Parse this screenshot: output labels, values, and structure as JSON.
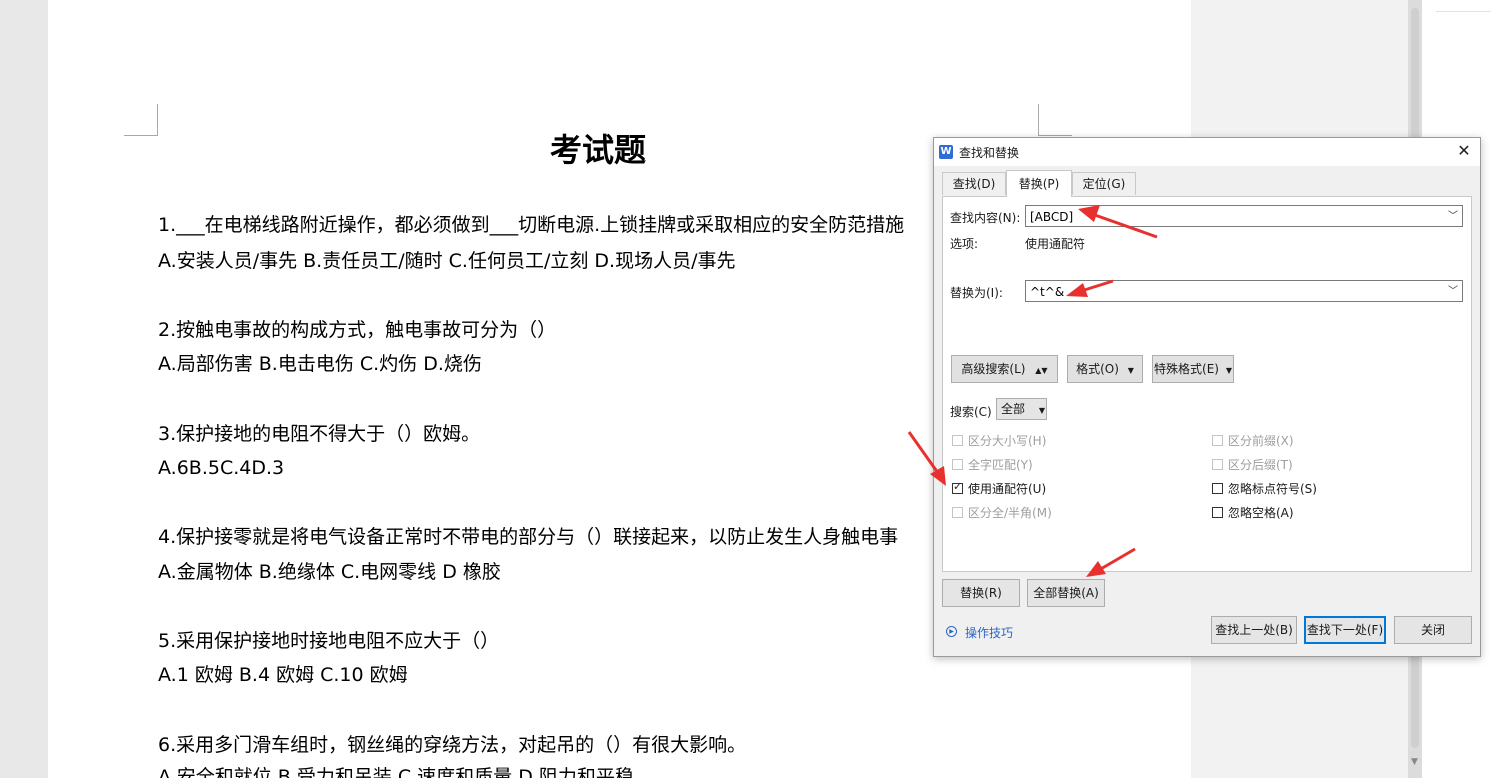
{
  "document": {
    "title": "考试题",
    "lines": [
      "1.___在电梯线路附近操作，都必须做到___切断电源.上锁挂牌或采取相应的安全防范措施",
      "A.安装人员/事先 B.责任员工/随时 C.任何员工/立刻 D.现场人员/事先",
      "2.按触电事故的构成方式，触电事故可分为（）",
      "A.局部伤害 B.电击电伤 C.灼伤 D.烧伤",
      "3.保护接地的电阻不得大于（）欧姆。",
      "A.6B.5C.4D.3",
      "4.保护接零就是将电气设备正常时不带电的部分与（）联接起来，以防止发生人身触电事",
      "A.金属物体 B.绝缘体 C.电网零线 D 橡胶",
      "5.采用保护接地时接地电阻不应大于（）",
      "A.1 欧姆 B.4 欧姆 C.10 欧姆",
      "6.采用多门滑车组时，钢丝绳的穿绕方法，对起吊的（）有很大影响。",
      "A.安全和就位 B.受力和吊装 C.速度和质量 D.阻力和平稳"
    ]
  },
  "dialog": {
    "app_icon": "W",
    "title": "查找和替换",
    "close": "✕",
    "tabs": [
      {
        "label": "查找(D)",
        "active": false
      },
      {
        "label": "替换(P)",
        "active": true
      },
      {
        "label": "定位(G)",
        "active": false
      }
    ],
    "find_label": "查找内容(N):",
    "find_value": "[ABCD]",
    "options_label": "选项:",
    "options_value": "使用通配符",
    "replace_label": "替换为(I):",
    "replace_value": "^t^&",
    "adv_search_btn": "高级搜索(L)",
    "format_btn": "格式(O)",
    "special_btn": "特殊格式(E)",
    "search_label": "搜索(C)",
    "search_value": "全部",
    "checkboxes": [
      {
        "label": "区分大小写(H)",
        "checked": false,
        "enabled": false
      },
      {
        "label": "全字匹配(Y)",
        "checked": false,
        "enabled": false
      },
      {
        "label": "使用通配符(U)",
        "checked": true,
        "enabled": true
      },
      {
        "label": "区分全/半角(M)",
        "checked": false,
        "enabled": false
      },
      {
        "label": "区分前缀(X)",
        "checked": false,
        "enabled": false
      },
      {
        "label": "区分后缀(T)",
        "checked": false,
        "enabled": false
      },
      {
        "label": "忽略标点符号(S)",
        "checked": false,
        "enabled": true
      },
      {
        "label": "忽略空格(A)",
        "checked": false,
        "enabled": true
      }
    ],
    "replace_btn": "替换(R)",
    "replace_all_btn": "全部替换(A)",
    "tips_link": "操作技巧",
    "find_prev_btn": "查找上一处(B)",
    "find_next_btn": "查找下一处(F)",
    "close_btn": "关闭"
  },
  "colors": {
    "annotation_arrow": "#e8312f",
    "link": "#2a66c9",
    "default_button_border": "#0078d7"
  }
}
